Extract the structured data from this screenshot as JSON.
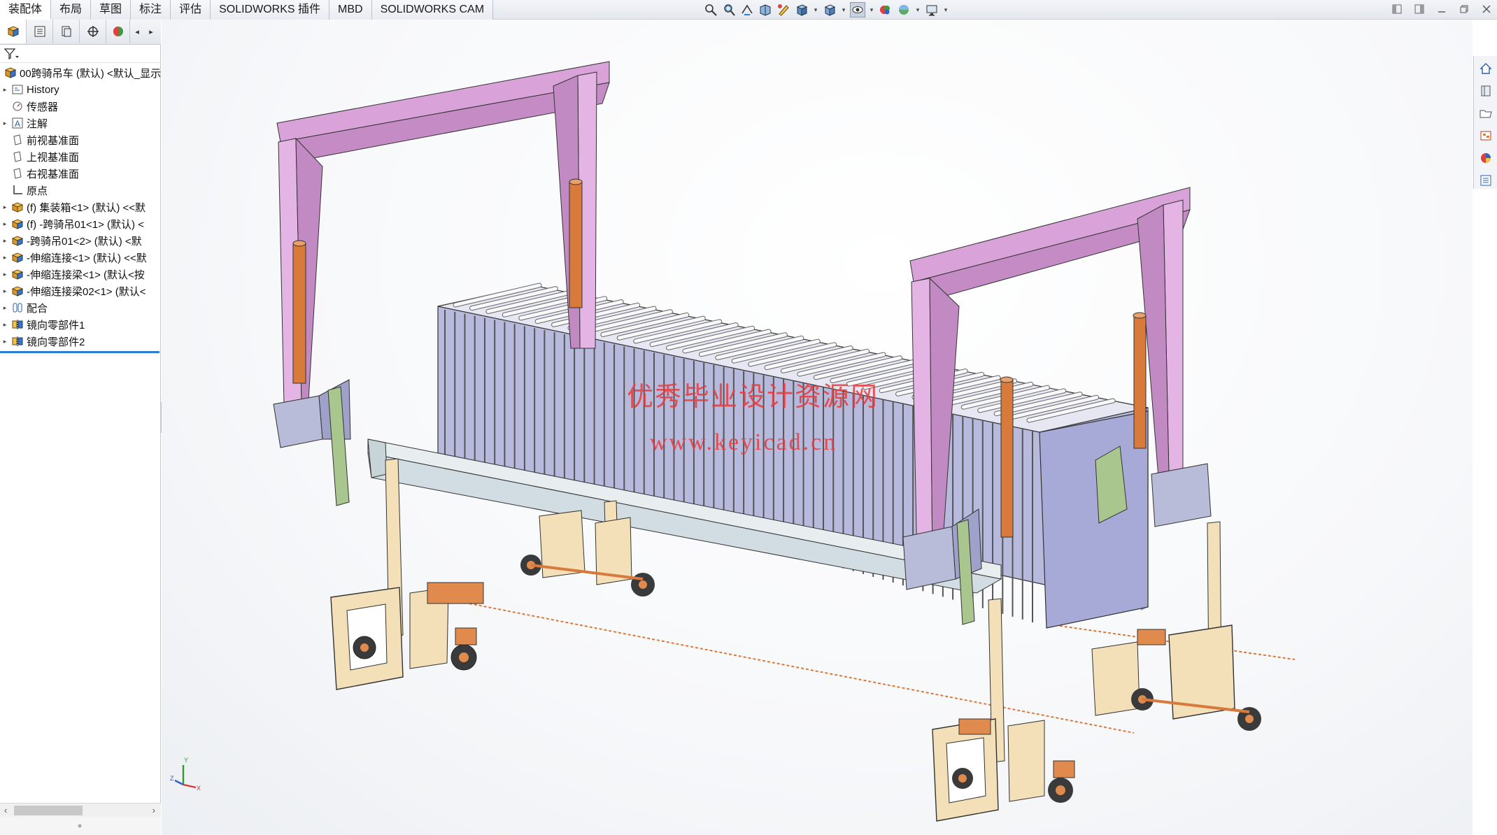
{
  "command_tabs": [
    "装配体",
    "布局",
    "草图",
    "标注",
    "评估",
    "SOLIDWORKS 插件",
    "MBD",
    "SOLIDWORKS CAM"
  ],
  "view_tools": [
    "zoom-to-fit-icon",
    "zoom-area-icon",
    "previous-view-icon",
    "section-view-icon",
    "dynamic-annotation-icon",
    "view-orientation-icon",
    "display-style-icon",
    "hide-show-items-icon",
    "edit-appearance-icon",
    "apply-scene-icon",
    "view-settings-icon"
  ],
  "tree": {
    "root": "00跨骑吊车 (默认) <默认_显示",
    "items": [
      {
        "label": "History",
        "icon": "history-icon",
        "expandable": true
      },
      {
        "label": "传感器",
        "icon": "sensor-icon",
        "expandable": false
      },
      {
        "label": "注解",
        "icon": "annotation-icon",
        "expandable": true
      },
      {
        "label": "前视基准面",
        "icon": "plane-icon",
        "expandable": false
      },
      {
        "label": "上视基准面",
        "icon": "plane-icon",
        "expandable": false
      },
      {
        "label": "右视基准面",
        "icon": "plane-icon",
        "expandable": false
      },
      {
        "label": "原点",
        "icon": "origin-icon",
        "expandable": false
      },
      {
        "label": "(f) 集装箱<1> (默认) <<默",
        "icon": "part-icon",
        "expandable": true
      },
      {
        "label": "(f) -跨骑吊01<1> (默认) <",
        "icon": "subassembly-icon",
        "expandable": true
      },
      {
        "label": "-跨骑吊01<2> (默认) <默",
        "icon": "subassembly-icon",
        "expandable": true
      },
      {
        "label": "-伸缩连接<1> (默认) <<默",
        "icon": "subassembly-icon",
        "expandable": true
      },
      {
        "label": "-伸缩连接梁<1> (默认<按",
        "icon": "subassembly-icon",
        "expandable": true
      },
      {
        "label": "-伸缩连接梁02<1> (默认<",
        "icon": "subassembly-icon",
        "expandable": true
      },
      {
        "label": "配合",
        "icon": "mates-icon",
        "expandable": true
      },
      {
        "label": "镜向零部件1",
        "icon": "mirror-component-icon",
        "expandable": true
      },
      {
        "label": "镜向零部件2",
        "icon": "mirror-component-icon",
        "expandable": true
      }
    ]
  },
  "watermark": {
    "line1": "优秀毕业设计资源网",
    "line2": "www.keyicad.cn"
  },
  "triad_labels": {
    "x": "X",
    "y": "Y",
    "z": "Z"
  },
  "colors": {
    "gantry_pink": "#d9a3d9",
    "container_blue": "#b7b9dd",
    "cylinder_orange": "#d87a3c",
    "leg_tan": "#f4e0b8",
    "wheel_dark": "#3a3a3a",
    "selection_blue": "#2a7fcf"
  }
}
